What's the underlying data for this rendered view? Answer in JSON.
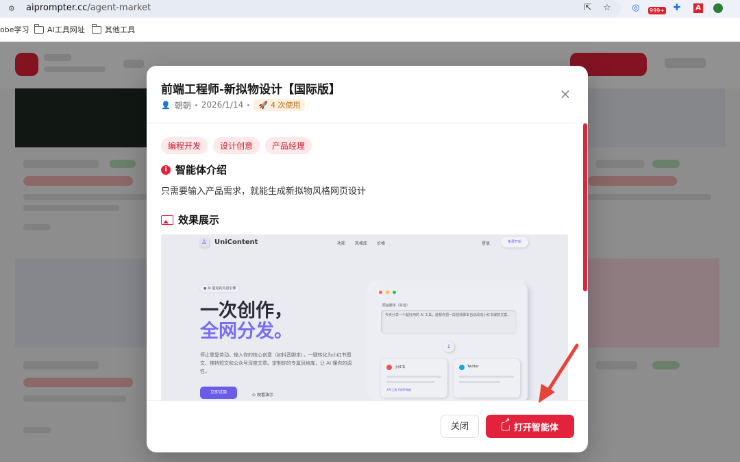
{
  "browser": {
    "url_host": "aiprompter.cc",
    "url_path": "/agent-market",
    "ext_badge": "999+",
    "bookmarks": [
      "obe学习",
      "AI工具网址",
      "其他工具"
    ]
  },
  "modal": {
    "title": "前端工程师-新拟物设计【国际版】",
    "author": "朝朝",
    "date": "2026/1/14",
    "usage": "4 次使用",
    "close_symbol": "×",
    "tags": [
      "编程开发",
      "设计创意",
      "产品经理"
    ],
    "intro_heading": "智能体介绍",
    "intro_text": "只需要输入产品需求，就能生成新拟物风格网页设计",
    "showcase_heading": "效果展示",
    "btn_close": "关闭",
    "btn_open": "打开智能体"
  },
  "preview": {
    "brand": "UniContent",
    "nav": [
      "功能",
      "风格库",
      "价格"
    ],
    "login": "登录",
    "cta": "免费开始",
    "badge": "AI 驱动的内容引擎",
    "headline1": "一次创作，",
    "headline2": "全网分发。",
    "subtitle": "停止重复劳动。输入你的核心创意（如抖音脚本），一键转化为小红书图文、推特短文和公众号深度文章。定制你的专属风格库，让 AI 懂你的调性。",
    "try_btn": "立即试用",
    "watch_demo": "观看演示",
    "card_label": "原始脚本（抖音）",
    "card_input": "今天分享一个超好用的 AI 工具，能帮你把一段视频脚本自动改成小红书爆款文案...",
    "mini1": "小红书",
    "mini2": "Twitter",
    "mini1_foot": "#AI工具 #效率神器",
    "colors": {
      "accent": "#6b5ce7",
      "brand_red": "#e3223c"
    }
  }
}
